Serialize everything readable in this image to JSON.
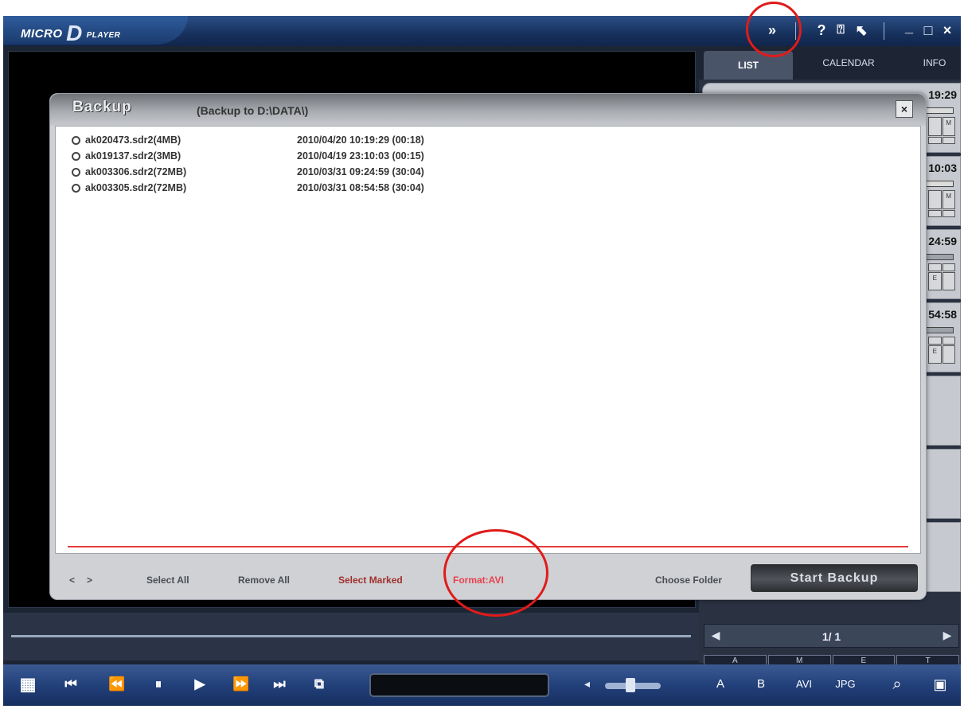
{
  "app": {
    "logo_main": "MICRO",
    "logo_d": "D",
    "logo_sub": "PLAYER"
  },
  "titlebar_icons": {
    "expand": "»",
    "help": "?",
    "search": "⍰",
    "settings": "⬉",
    "minimize": "_",
    "maximize": "□",
    "close": "×"
  },
  "right_panel": {
    "tabs": [
      "LIST",
      "CALENDAR",
      "INFO"
    ],
    "active_tab": "LIST",
    "cards": [
      {
        "time": "19:29",
        "grid": [
          "",
          "M",
          "",
          ""
        ]
      },
      {
        "time": "10:03",
        "grid": [
          "",
          "M",
          "",
          ""
        ]
      },
      {
        "time": "24:59",
        "grid": [
          "",
          "",
          "E",
          ""
        ]
      },
      {
        "time": "54:58",
        "grid": [
          "",
          "",
          "E",
          ""
        ]
      }
    ],
    "pager_text": "1/  1",
    "pager_prev": "◀",
    "pager_next": "▶",
    "filters": [
      "A",
      "M",
      "E",
      "T"
    ]
  },
  "dialog": {
    "title": "Backup",
    "subtitle": "(Backup to D:\\DATA\\)",
    "close": "×",
    "files": [
      {
        "name": "ak020473.sdr2(4MB)",
        "date": "2010/04/20 10:19:29 (00:18)"
      },
      {
        "name": "ak019137.sdr2(3MB)",
        "date": "2010/04/19 23:10:03 (00:15)"
      },
      {
        "name": "ak003306.sdr2(72MB)",
        "date": "2010/03/31 09:24:59 (30:04)"
      },
      {
        "name": "ak003305.sdr2(72MB)",
        "date": "2010/03/31 08:54:58 (30:04)"
      }
    ],
    "footer": {
      "prev": "<",
      "next": ">",
      "select_all": "Select All",
      "remove_all": "Remove All",
      "select_marked": "Select Marked",
      "format": "Format:AVI",
      "choose_folder": "Choose Folder",
      "start_backup": "Start Backup"
    }
  },
  "toolbar": {
    "grid": "▦",
    "first": "⏮",
    "rewind": "⏪",
    "pause": "⏸",
    "play": "▶",
    "forward": "⏩",
    "last": "⏭",
    "copy": "⧉",
    "btn_a": "A",
    "btn_b": "B",
    "btn_avi": "AVI",
    "btn_jpg": "JPG",
    "btn_search": "⌕",
    "btn_folder": "▣"
  }
}
